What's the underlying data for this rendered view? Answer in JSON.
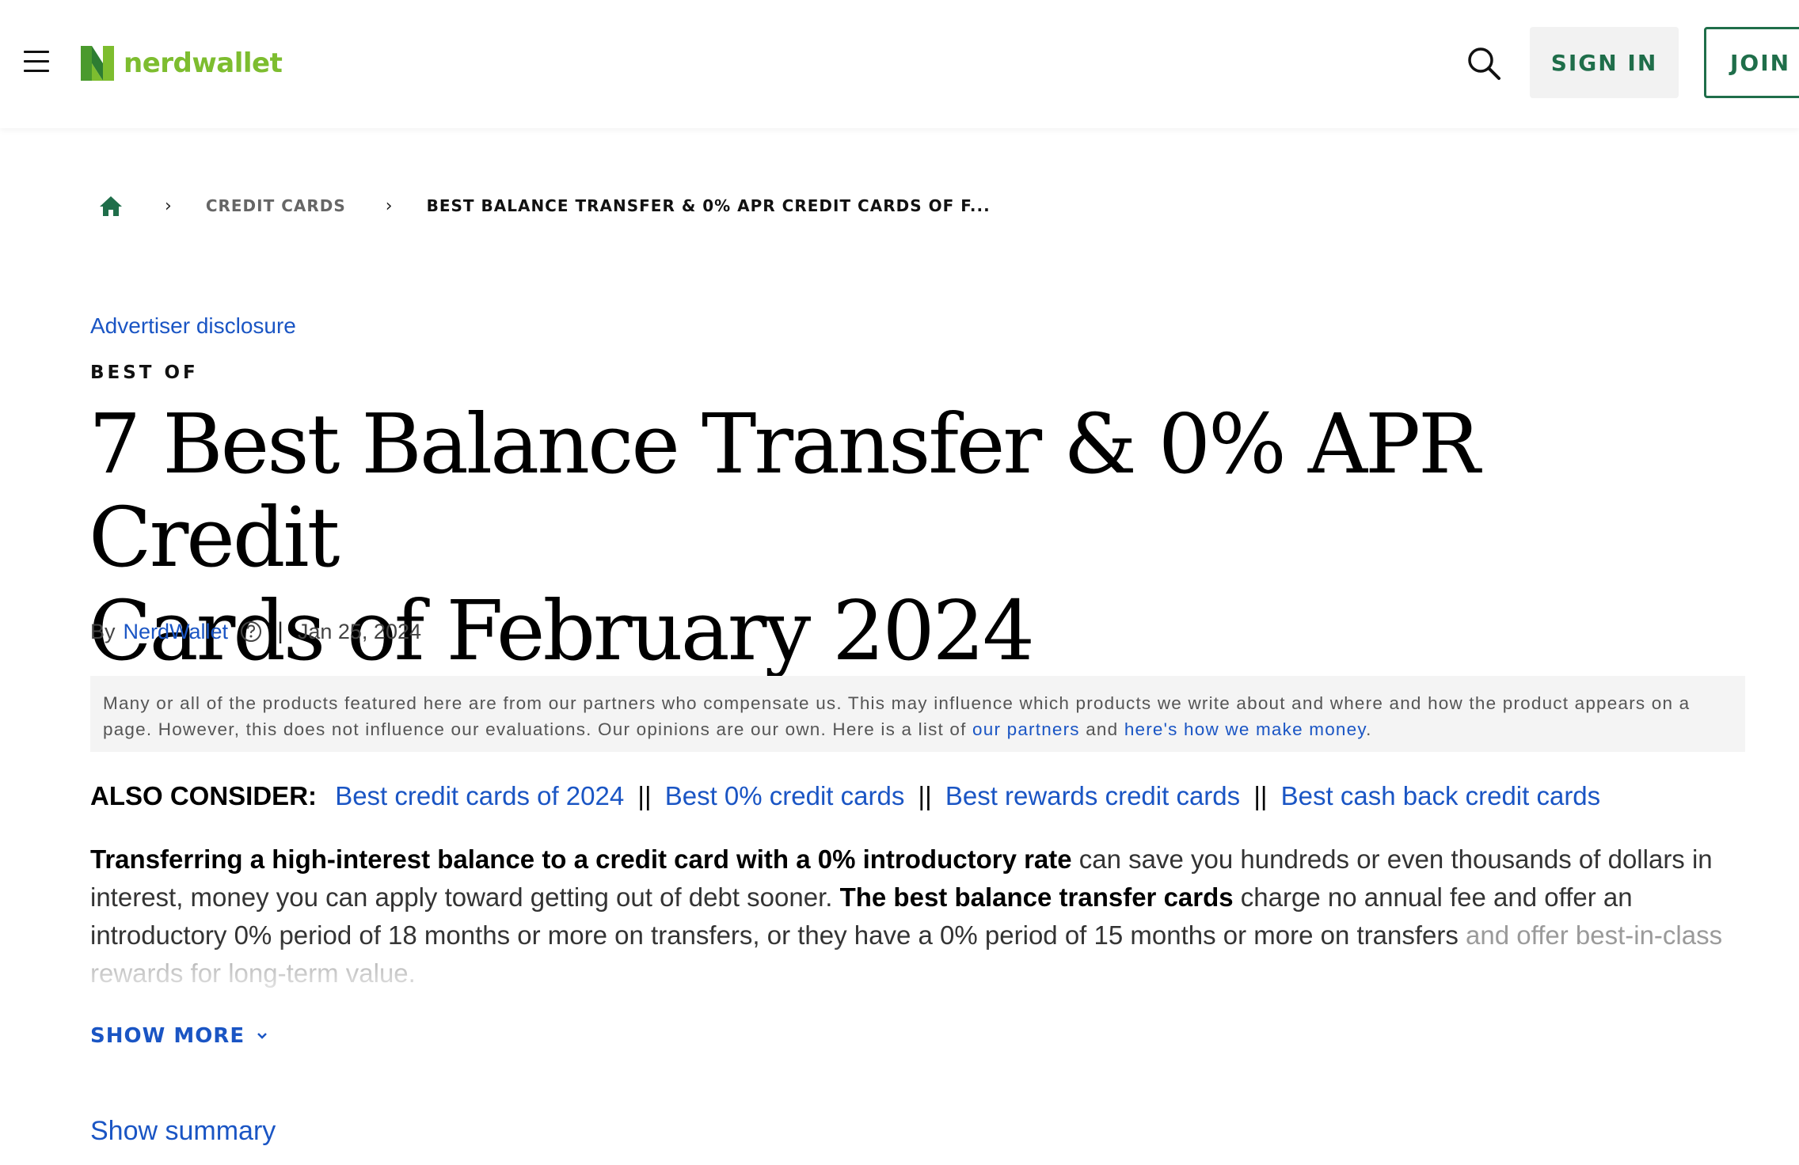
{
  "header": {
    "logo_text": "nerdwallet",
    "signin_label": "SIGN IN",
    "join_label": "JOIN",
    "brand_green": "#7dbd2f",
    "dark_green": "#1f6e4a"
  },
  "breadcrumb": {
    "items": [
      {
        "label": "CREDIT CARDS"
      },
      {
        "label": "BEST BALANCE TRANSFER & 0% APR CREDIT CARDS OF F..."
      }
    ]
  },
  "article": {
    "disclosure": "Advertiser disclosure",
    "eyebrow": "BEST OF",
    "title_line1": "7 Best Balance Transfer & 0% APR Credit",
    "title_line2": "Cards of February 2024",
    "by": "By",
    "author": "NerdWallet",
    "date": "Jan 25, 2024",
    "partner_text_1": "Many or all of the products featured here are from our partners who compensate us. This may influence which products we write about and where and how the product appears on a page. However, this does not influence our evaluations. Our opinions are our own. Here is a list of ",
    "partner_link_1": "our partners",
    "partner_text_2": " and ",
    "partner_link_2": "here's how we make money",
    "partner_text_3": ".",
    "also_consider_label": "ALSO CONSIDER:",
    "also_consider_sep": "||",
    "also_consider_links": [
      "Best credit cards of 2024",
      "Best 0% credit cards",
      "Best rewards credit cards",
      "Best cash back credit cards"
    ],
    "intro_bold_1": "Transferring a high-interest balance to a credit card with a 0% introductory rate",
    "intro_text_1": " can save you hundreds or even thousands of dollars in interest, money you can apply toward getting out of debt sooner. ",
    "intro_bold_2": "The best balance transfer cards",
    "intro_text_2": " charge no annual fee and offer an introductory 0% period of 18 months or more on transfers, or they have a 0% period of 15 months or more on transfers ",
    "intro_text_3": "and offer best-in-class rewards for long-term value.",
    "show_more": "SHOW MORE",
    "show_summary": "Show summary",
    "link_color": "#1a55c4"
  },
  "icons": {
    "menu": "hamburger-menu-icon",
    "search": "search-icon",
    "home": "home-icon",
    "help": "question-circle-icon",
    "chevron": "chevron-down-icon"
  }
}
